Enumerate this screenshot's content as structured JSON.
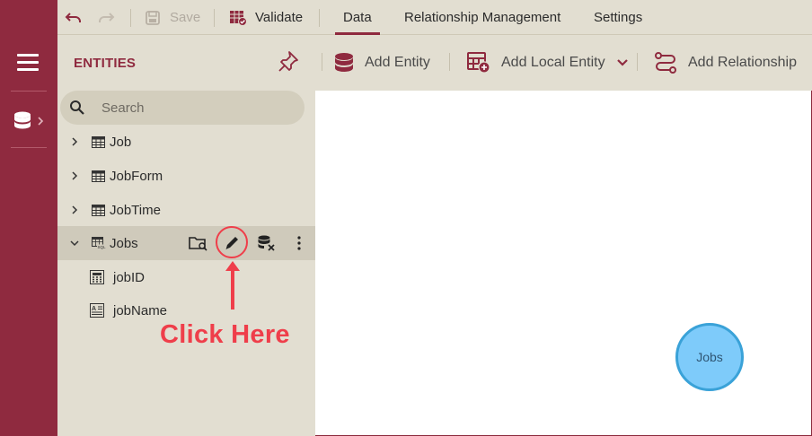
{
  "topbar": {
    "undo_icon": "undo-icon",
    "redo_icon": "redo-icon",
    "save_label": "Save",
    "validate_label": "Validate",
    "tabs": [
      {
        "label": "Data",
        "active": true
      },
      {
        "label": "Relationship Management",
        "active": false
      },
      {
        "label": "Settings",
        "active": false
      }
    ]
  },
  "rail": {
    "menu_icon": "hamburger-icon",
    "database_icon": "database-icon"
  },
  "panel": {
    "title": "ENTITIES",
    "search_placeholder": "Search",
    "entities": [
      {
        "label": "Job",
        "expanded": false
      },
      {
        "label": "JobForm",
        "expanded": false
      },
      {
        "label": "JobTime",
        "expanded": false
      },
      {
        "label": "Jobs",
        "expanded": true,
        "selected": true
      }
    ],
    "fields": [
      {
        "label": "jobID",
        "icon": "numeric-field-icon"
      },
      {
        "label": "jobName",
        "icon": "text-field-icon"
      }
    ]
  },
  "actions": {
    "add_entity": "Add Entity",
    "add_local_entity": "Add Local Entity",
    "add_relationship": "Add Relationship"
  },
  "annotation": {
    "callout": "Click Here"
  },
  "canvas": {
    "node_label": "Jobs"
  },
  "colors": {
    "brand": "#8f2a3f",
    "panel_bg": "#e2ded1",
    "selected_row": "#cfcabb",
    "annotation": "#ef3e4a",
    "node_fill": "#7ecbfa",
    "node_border": "#3aa2d8"
  }
}
